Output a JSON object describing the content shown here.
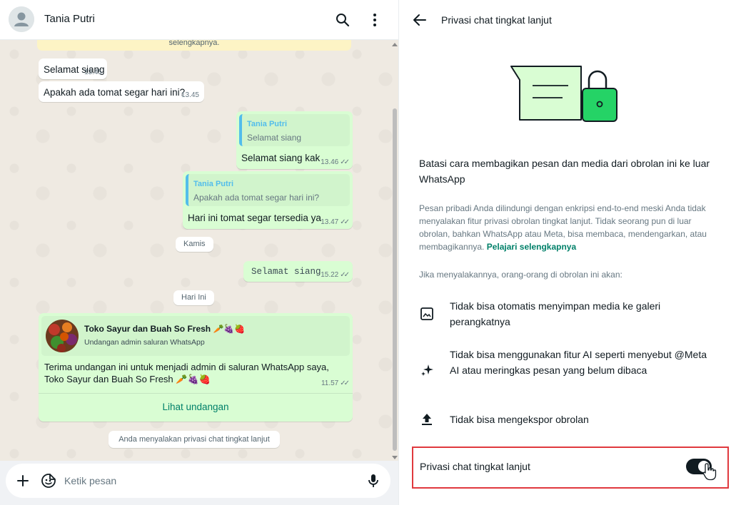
{
  "chat": {
    "contact_name": "Tania Putri",
    "system_top": "selengkapnya.",
    "messages": [
      {
        "text": "Selamat siang",
        "time": "13.45"
      },
      {
        "text": "Apakah ada tomat segar hari ini?",
        "time": "13.45"
      },
      {
        "quote_name": "Tania Putri",
        "quote_text": "Selamat siang",
        "text": "Selamat siang kak",
        "time": "13.46"
      },
      {
        "quote_name": "Tania Putri",
        "quote_text": "Apakah ada tomat segar hari ini?",
        "text": "Hari ini tomat segar tersedia ya",
        "time": "13.47"
      },
      {
        "text": "Selamat siang",
        "time": "15.22"
      }
    ],
    "date_chips": [
      "Kamis",
      "Hari Ini"
    ],
    "invite": {
      "channel_name": "Toko Sayur dan Buah So Fresh 🥕🍇🍓",
      "channel_sub": "Undangan admin saluran WhatsApp",
      "text": "Terima undangan ini untuk menjadi admin di saluran WhatsApp saya, Toko Sayur dan Buah So Fresh 🥕🍇🍓",
      "time": "11.57",
      "link_label": "Lihat undangan"
    },
    "system_bottom": "Anda menyalakan privasi chat tingkat lanjut",
    "composer_placeholder": "Ketik pesan"
  },
  "settings": {
    "title": "Privasi chat tingkat lanjut",
    "lead": "Batasi cara membagikan pesan dan media dari obrolan ini ke luar WhatsApp",
    "desc": "Pesan pribadi Anda dilindungi dengan enkripsi end-to-end meski Anda tidak menyalakan fitur privasi obrolan tingkat lanjut. Tidak seorang pun di luar obrolan, bahkan WhatsApp atau Meta, bisa membaca, mendengarkan, atau membagikannya.",
    "desc_link": "Pelajari selengkapnya",
    "subhead": "Jika menyalakannya, orang-orang di obrolan ini akan:",
    "features": [
      {
        "icon": "image-icon",
        "text": "Tidak bisa otomatis menyimpan media ke galeri perangkatnya"
      },
      {
        "icon": "sparkle-ai-icon",
        "text": "Tidak bisa menggunakan fitur AI seperti menyebut @Meta AI atau meringkas pesan yang belum dibaca"
      },
      {
        "icon": "upload-icon",
        "text": "Tidak bisa mengekspor obrolan"
      }
    ],
    "toggle_label": "Privasi chat tingkat lanjut",
    "toggle_on": true
  },
  "colors": {
    "outgoing_bubble": "#d9fdd3",
    "incoming_bubble": "#ffffff",
    "accent_green": "#008069",
    "quote_bar": "#53bdeb",
    "highlight_border": "#e0393e",
    "lock_green": "#25d366"
  }
}
